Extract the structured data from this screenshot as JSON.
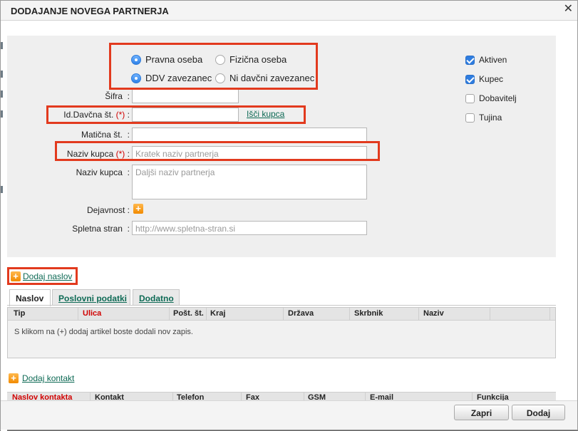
{
  "dialog": {
    "title": "DODAJANJE NOVEGA PARTNERJA",
    "close_glyph": "✕"
  },
  "form": {
    "radios": {
      "pravna": "Pravna oseba",
      "fizicna": "Fizična oseba",
      "ddv": "DDV zavezanec",
      "ni_ddv": "Ni davčni zavezanec"
    },
    "sifra_label": "Šifra",
    "id_davcna_label": "Id.Davčna št.",
    "required_marker": "(*)",
    "isci_kupca": "Išči kupca",
    "maticna_label": "Matična št.",
    "naziv_kupca_label": "Naziv kupca",
    "naziv_kupca_placeholder": "Kratek naziv partnerja",
    "naziv_kupca2_label": "Naziv kupca",
    "naziv_kupca2_placeholder": "Daljši naziv partnerja",
    "dejavnost_label": "Dejavnost",
    "spletna_label": "Spletna stran",
    "spletna_placeholder": "http://www.spletna-stran.si",
    "colon": ":",
    "checkboxes": {
      "aktiven": "Aktiven",
      "kupec": "Kupec",
      "dobavitelj": "Dobavitelj",
      "tujina": "Tujina"
    }
  },
  "addresses": {
    "add_link": "Dodaj naslov",
    "tabs": [
      "Naslov",
      "Poslovni podatki",
      "Dodatno"
    ],
    "columns": [
      "Tip",
      "Ulica",
      "Pošt. št.",
      "Kraj",
      "Država",
      "Skrbnik",
      "Naziv"
    ],
    "empty_message": "S klikom na (+) dodaj artikel boste dodali nov zapis."
  },
  "contacts": {
    "add_link": "Dodaj kontakt",
    "columns": [
      "Naslov kontakta",
      "Kontakt",
      "Telefon",
      "Fax",
      "GSM",
      "E-mail",
      "Funkcija"
    ]
  },
  "footer": {
    "zapri": "Zapri",
    "dodaj": "Dodaj"
  },
  "colors": {
    "highlight": "#e23a1e",
    "link": "#0e6a55",
    "required": "#d00000",
    "checkbox_on": "#2f7de0"
  }
}
